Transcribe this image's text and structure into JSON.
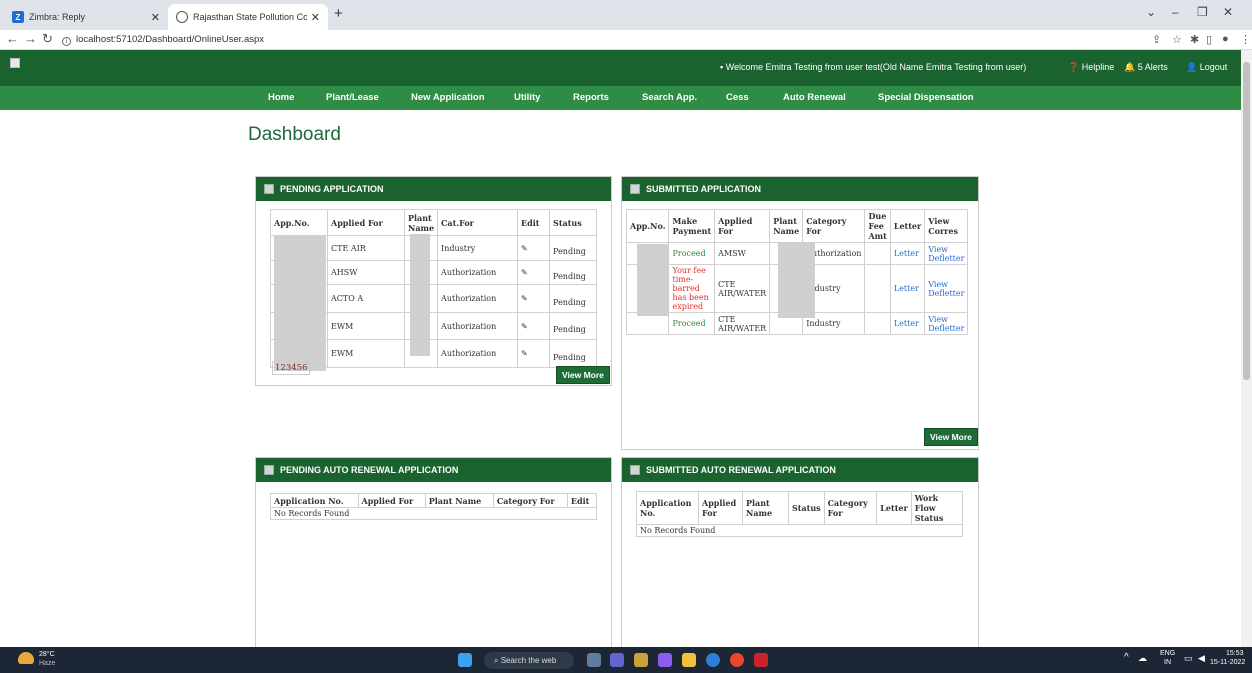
{
  "browser": {
    "tabs": [
      {
        "title": "Zimbra: Reply"
      },
      {
        "title": "Rajasthan State Pollution Control"
      }
    ],
    "url": "localhost:57102/Dashboard/OnlineUser.aspx"
  },
  "header": {
    "welcome": "Welcome Emitra Testing from user test(Old Name Emitra Testing from user)",
    "helpline": "Helpline",
    "alerts": "5 Alerts",
    "logout": "Logout"
  },
  "menu": [
    "Home",
    "Plant/Lease",
    "New Application",
    "Utility",
    "Reports",
    "Search App.",
    "Cess",
    "Auto Renewal",
    "Special Dispensation"
  ],
  "page_title": "Dashboard",
  "pending": {
    "title": "PENDING APPLICATION",
    "headers": [
      "App.No.",
      "Applied For",
      "Plant Name",
      "Cat.For",
      "Edit",
      "Status"
    ],
    "rows": [
      {
        "applied": "CTE AIR",
        "cat": "Industry",
        "status": "Pending"
      },
      {
        "applied": "AHSW",
        "cat": "Authorization",
        "status": "Pending"
      },
      {
        "applied": "ACTO A",
        "cat": "Authorization",
        "status": "Pending"
      },
      {
        "applied": "EWM",
        "cat": "Authorization",
        "status": "Pending"
      },
      {
        "applied": "EWM",
        "cat": "Authorization",
        "status": "Pending"
      }
    ],
    "pager": "123456",
    "view_more": "View More"
  },
  "submitted": {
    "title": "SUBMITTED APPLICATION",
    "headers": [
      "App.No.",
      "Make Payment",
      "Applied For",
      "Plant Name",
      "Category For",
      "Due Fee Amt",
      "Letter",
      "View Corres"
    ],
    "rows": [
      {
        "pay": "Proceed",
        "applied": "AMSW",
        "cat": "Authorization",
        "letter": "Letter",
        "view": "View Defletter"
      },
      {
        "pay": "Your fee time-barred has been expired",
        "applied": "CTE AIR/WATER",
        "cat": "Industry",
        "letter": "Letter",
        "view": "View Defletter"
      },
      {
        "pay": "Proceed",
        "applied": "CTE AIR/WATER",
        "cat": "Industry",
        "letter": "Letter",
        "view": "View Defletter"
      }
    ],
    "view_more": "View More"
  },
  "pending_auto": {
    "title": "PENDING AUTO RENEWAL APPLICATION",
    "headers": [
      "Application No.",
      "Applied For",
      "Plant Name",
      "Category For",
      "Edit"
    ],
    "empty": "No Records Found"
  },
  "submitted_auto": {
    "title": "SUBMITTED AUTO RENEWAL APPLICATION",
    "headers": [
      "Application No.",
      "Applied For",
      "Plant Name",
      "Status",
      "Category For",
      "Letter",
      "Work Flow Status"
    ],
    "empty": "No Records Found"
  },
  "taskbar": {
    "temp": "28°C",
    "weather": "Haze",
    "search": "Search the web",
    "lang": "ENG",
    "region": "IN",
    "time": "15:53",
    "date": "15-11-2022"
  }
}
